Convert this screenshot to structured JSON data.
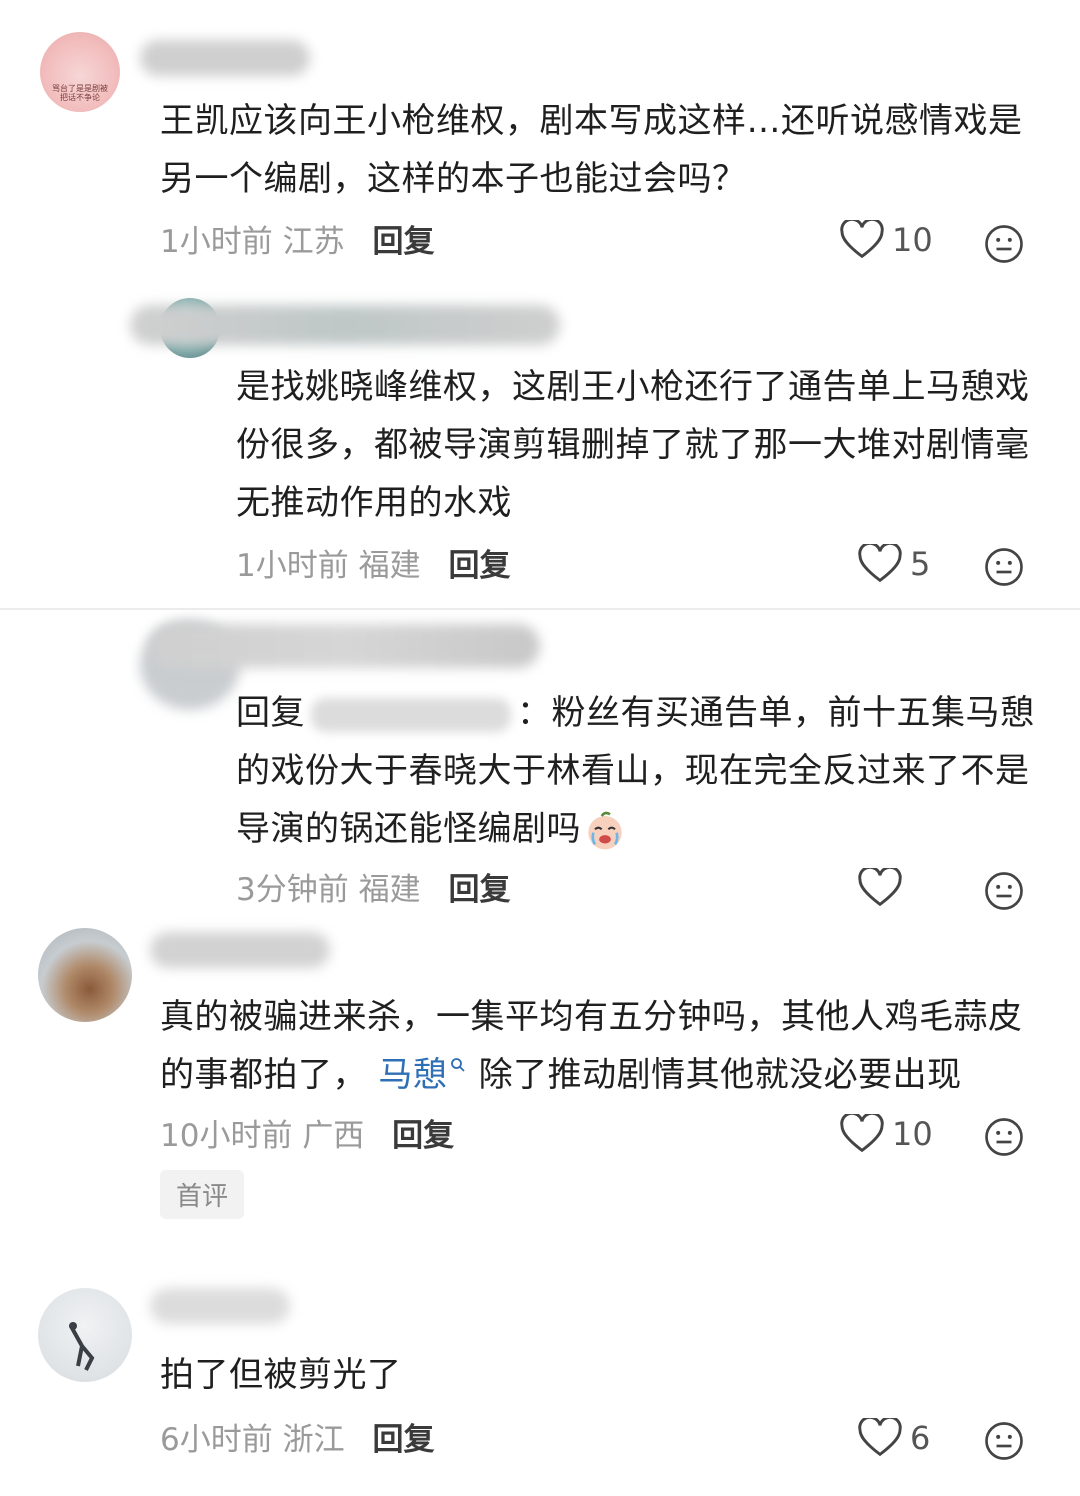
{
  "comments": [
    {
      "text": "王凯应该向王小枪维权，剧本写成这样…还听说感情戏是另一个编剧，这样的本子也能过会吗？",
      "time": "1小时前",
      "location": "江苏",
      "reply_label": "回复",
      "likes": "10",
      "avatar_caption": "骂台了是是剧被 把话不争论"
    },
    {
      "text": "是找姚晓峰维权，这剧王小枪还行了通告单上马憩戏份很多，都被导演剪辑删掉了就了那一大堆对剧情毫无推动作用的水戏",
      "time": "1小时前",
      "location": "福建",
      "reply_label": "回复",
      "likes": "5"
    },
    {
      "reply_prefix": "回复",
      "text": "：粉丝有买通告单，前十五集马憩的戏份大于春晓大于林看山，现在完全反过来了不是导演的锅还能怪编剧吗",
      "time": "3分钟前",
      "location": "福建",
      "reply_label": "回复",
      "likes": ""
    },
    {
      "text_before": "真的被骗进来杀，一集平均有五分钟吗，其他人鸡毛蒜皮的事都拍了，",
      "mention": "马憩",
      "text_after": "除了推动剧情其他就没必要出现",
      "time": "10小时前",
      "location": "广西",
      "reply_label": "回复",
      "likes": "10",
      "badge": "首评"
    },
    {
      "text": "拍了但被剪光了",
      "time": "6小时前",
      "location": "浙江",
      "reply_label": "回复",
      "likes": "6"
    }
  ],
  "icons": {
    "like": "heart-outline-icon",
    "emoji": "neutral-face-icon",
    "sticker": "crying-face-emoji"
  },
  "colors": {
    "mention": "#2f6fb5",
    "meta": "#9a9a9a"
  }
}
